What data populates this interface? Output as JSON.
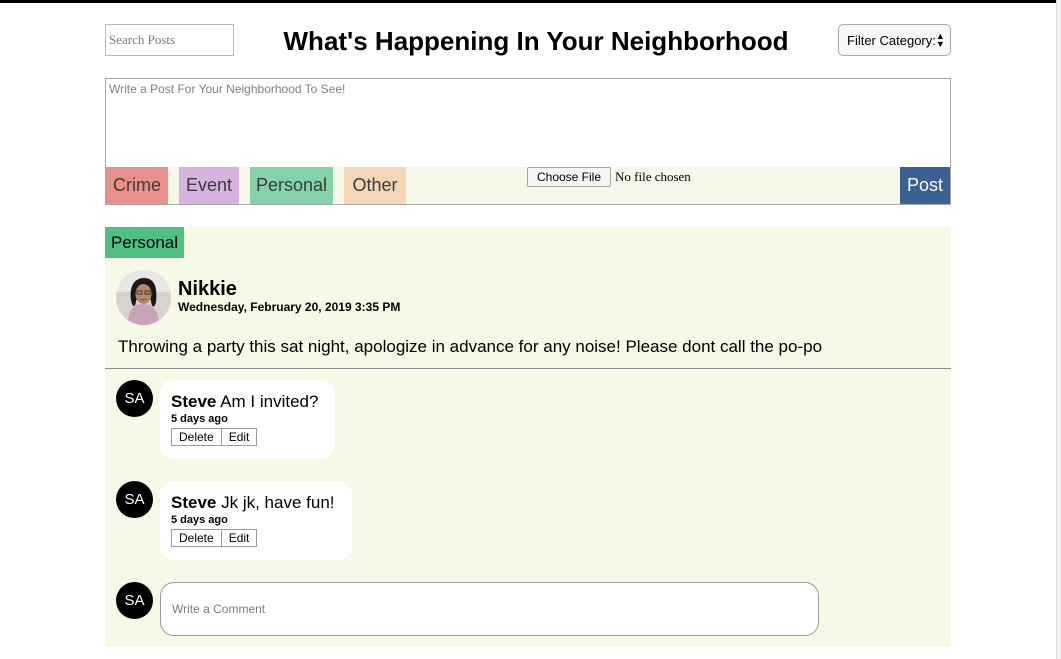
{
  "header": {
    "search_placeholder": "Search Posts",
    "title": "What's Happening In Your Neighborhood",
    "filter_label": "Filter Category:"
  },
  "composer": {
    "placeholder": "Write a Post For Your Neighborhood To See!",
    "categories": [
      {
        "label": "Crime",
        "color": "#e8918b"
      },
      {
        "label": "Event",
        "color": "#d5b3de"
      },
      {
        "label": "Personal",
        "color": "#84d2a8"
      },
      {
        "label": "Other",
        "color": "#f4d7b5"
      }
    ],
    "choose_file_label": "Choose File",
    "file_status": "No file chosen",
    "post_label": "Post"
  },
  "post": {
    "category": "Personal",
    "category_color": "#4fbf84",
    "author": "Nikkie",
    "date": "Wednesday, February 20, 2019 3:35 PM",
    "body": "Throwing a party this sat night, apologize in advance for any noise! Please dont call the po-po",
    "comments": [
      {
        "initials": "SA",
        "author": "Steve",
        "text": "Am I invited?",
        "time": "5 days ago",
        "delete_label": "Delete",
        "edit_label": "Edit"
      },
      {
        "initials": "SA",
        "author": "Steve",
        "text": "Jk jk, have fun!",
        "time": "5 days ago",
        "delete_label": "Delete",
        "edit_label": "Edit"
      }
    ],
    "new_comment": {
      "initials": "SA",
      "placeholder": "Write a Comment"
    }
  }
}
